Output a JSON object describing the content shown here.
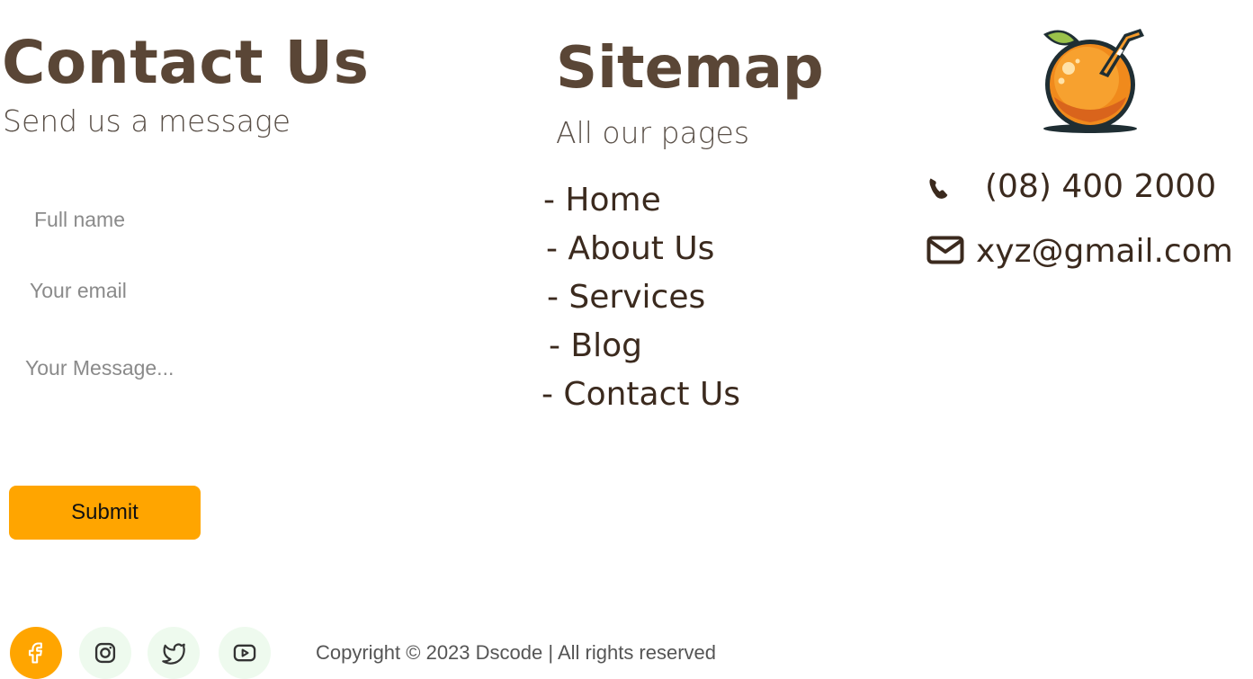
{
  "contact": {
    "title": "Contact Us",
    "subtitle": "Send us a message",
    "name_placeholder": "Full name",
    "email_placeholder": "Your email",
    "message_placeholder": "Your Message...",
    "submit_label": "Submit"
  },
  "sitemap": {
    "title": "Sitemap",
    "subtitle": "All our pages",
    "links": [
      {
        "label": "- Home"
      },
      {
        "label": "- About Us"
      },
      {
        "label": "- Services"
      },
      {
        "label": "- Blog"
      },
      {
        "label": "- Contact Us"
      }
    ]
  },
  "info": {
    "logo_icon": "orange-juice-logo",
    "phone_icon": "phone-icon",
    "phone": "(08) 400 2000",
    "email_icon": "envelope-icon",
    "email": "xyz@gmail.com"
  },
  "footer": {
    "social": [
      {
        "icon": "facebook-icon"
      },
      {
        "icon": "instagram-icon"
      },
      {
        "icon": "twitter-icon"
      },
      {
        "icon": "youtube-icon"
      }
    ],
    "copyright": "Copyright  ©  2023 Dscode | All rights reserved"
  },
  "colors": {
    "accent": "#ffa500",
    "heading": "#5a4636",
    "text": "#3b2a1e",
    "social_bg": "#eefaee"
  }
}
